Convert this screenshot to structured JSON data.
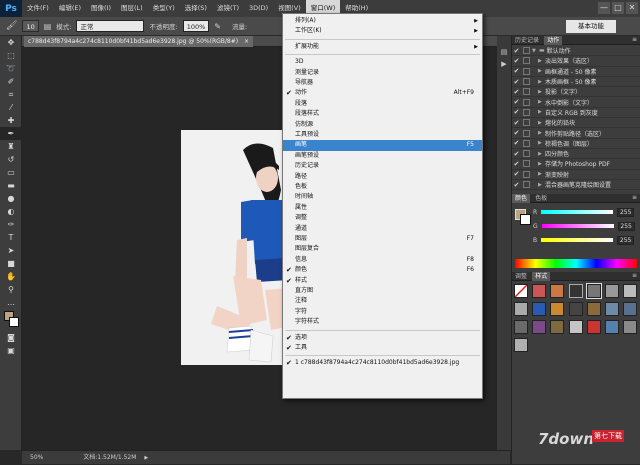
{
  "app": {
    "logo": "Ps"
  },
  "menubar": {
    "items": [
      "文件(F)",
      "编辑(E)",
      "图像(I)",
      "图层(L)",
      "类型(Y)",
      "选择(S)",
      "滤镜(T)",
      "3D(D)",
      "视图(V)",
      "窗口(W)",
      "帮助(H)"
    ],
    "active_index": 9,
    "win_buttons": [
      "—",
      "□",
      "✕"
    ]
  },
  "options": {
    "brush_size": "10",
    "mode_label": "模式:",
    "mode_value": "正常",
    "opacity_label": "不透明度:",
    "opacity_value": "100%",
    "flow_label": "流量:",
    "workspace": "基本功能"
  },
  "document": {
    "tab_title": "c788d43f8794a4c274c8110d0bf41bd5ad6e3928.jpg @ 50%(RGB/8#)",
    "tab_close": "×",
    "zoom": "50%",
    "doc_info": "文档:1.52M/1.52M"
  },
  "window_menu": {
    "items": [
      {
        "label": "排列(A)",
        "submenu": true
      },
      {
        "label": "工作区(K)",
        "submenu": true
      },
      {
        "sep": true
      },
      {
        "label": "扩展功能",
        "submenu": true
      },
      {
        "sep": true
      },
      {
        "label": "3D"
      },
      {
        "label": "测量记录"
      },
      {
        "label": "导航器"
      },
      {
        "label": "动作",
        "checked": true,
        "shortcut": "Alt+F9"
      },
      {
        "label": "段落"
      },
      {
        "label": "段落样式"
      },
      {
        "label": "仿制源"
      },
      {
        "label": "工具预设"
      },
      {
        "label": "画笔",
        "shortcut": "F5",
        "highlight": true
      },
      {
        "label": "画笔预设"
      },
      {
        "label": "历史记录"
      },
      {
        "label": "路径"
      },
      {
        "label": "色板"
      },
      {
        "label": "时间轴"
      },
      {
        "label": "属性"
      },
      {
        "label": "调整"
      },
      {
        "label": "通道"
      },
      {
        "label": "图层",
        "shortcut": "F7"
      },
      {
        "label": "图层复合"
      },
      {
        "label": "信息",
        "shortcut": "F8"
      },
      {
        "label": "颜色",
        "checked": true,
        "shortcut": "F6"
      },
      {
        "label": "样式",
        "checked": true
      },
      {
        "label": "直方图"
      },
      {
        "label": "注释"
      },
      {
        "label": "字符"
      },
      {
        "label": "字符样式"
      },
      {
        "sep": true
      },
      {
        "label": "选项",
        "checked": true
      },
      {
        "label": "工具",
        "checked": true
      },
      {
        "sep": true
      },
      {
        "label": "1 c788d43f8794a4c274c8110d0bf41bd5ad6e3928.jpg",
        "checked": true
      }
    ]
  },
  "actions_panel": {
    "tabs": [
      "历史记录",
      "动作"
    ],
    "active_tab": 1,
    "set_name": "默认动作",
    "items": [
      "淡出效果（选区）",
      "画框通道 - 50 像素",
      "木质画框 - 50 像素",
      "投影（文字）",
      "水中倒影（文字）",
      "自定义 RGB 到灰度",
      "熔化的铅块",
      "制作剪贴路径（选区）",
      "棕褐色调（图层）",
      "四分颜色",
      "存储为 Photoshop PDF",
      "渐变映射",
      "混合器画笔克隆绘图设置"
    ]
  },
  "color_panel": {
    "tabs": [
      "颜色",
      "色板"
    ],
    "channels": [
      {
        "label": "R",
        "value": "255"
      },
      {
        "label": "G",
        "value": "255"
      },
      {
        "label": "B",
        "value": "255"
      }
    ]
  },
  "styles_panel": {
    "tabs": [
      "调整",
      "样式"
    ],
    "active_tab": 1
  },
  "watermark": {
    "brand": "7down",
    "tag": "第七下载"
  },
  "colors": {
    "accent": "#3a84ce",
    "panel": "#3d3d3d",
    "canvas": "#262626"
  }
}
